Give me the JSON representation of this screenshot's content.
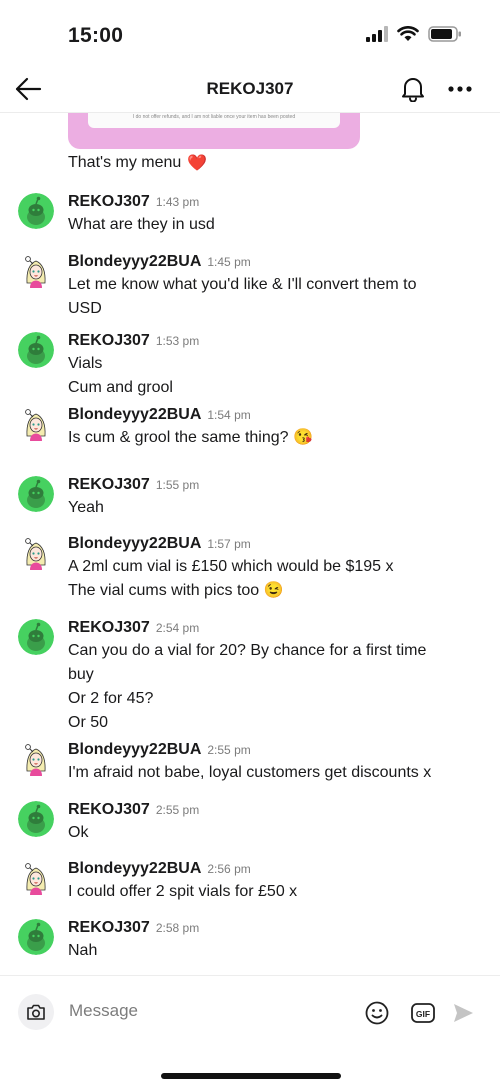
{
  "status_bar": {
    "time": "15:00"
  },
  "header": {
    "title": "REKOJ307"
  },
  "menu": {
    "fine_print": "I do not offer refunds, and I am not liable once your item has been posted",
    "caption": "That's my menu",
    "caption_emoji": "❤️"
  },
  "messages": [
    {
      "author": "REKOJ307",
      "time": "1:43 pm",
      "avatar": "snoo-avatar",
      "lines": [
        "What are they in usd"
      ]
    },
    {
      "author": "Blondeyyy22BUA",
      "time": "1:45 pm",
      "avatar": "blonde-avatar",
      "lines": [
        "Let me know what you'd like & I'll convert them to",
        "USD"
      ]
    },
    {
      "author": "REKOJ307",
      "time": "1:53 pm",
      "avatar": "snoo-avatar",
      "lines": [
        "Vials",
        "Cum and grool"
      ]
    },
    {
      "author": "Blondeyyy22BUA",
      "time": "1:54 pm",
      "avatar": "blonde-avatar",
      "lines": [
        "Is cum & grool the same thing? 😘"
      ]
    },
    {
      "author": "REKOJ307",
      "time": "1:55 pm",
      "avatar": "snoo-avatar",
      "lines": [
        "Yeah"
      ]
    },
    {
      "author": "Blondeyyy22BUA",
      "time": "1:57 pm",
      "avatar": "blonde-avatar",
      "lines": [
        "A 2ml cum vial is £150 which would be $195 x",
        "The vial cums with pics too 😉"
      ]
    },
    {
      "author": "REKOJ307",
      "time": "2:54 pm",
      "avatar": "snoo-avatar",
      "lines": [
        "Can you do a vial for 20? By chance for a first time",
        "buy",
        "Or 2 for 45?",
        "Or 50"
      ]
    },
    {
      "author": "Blondeyyy22BUA",
      "time": "2:55 pm",
      "avatar": "blonde-avatar",
      "lines": [
        "I'm afraid not babe, loyal customers get discounts x"
      ]
    },
    {
      "author": "REKOJ307",
      "time": "2:55 pm",
      "avatar": "snoo-avatar",
      "lines": [
        "Ok"
      ]
    },
    {
      "author": "Blondeyyy22BUA",
      "time": "2:56 pm",
      "avatar": "blonde-avatar",
      "lines": [
        "I could offer 2 spit vials for £50 x"
      ]
    },
    {
      "author": "REKOJ307",
      "time": "2:58 pm",
      "avatar": "snoo-avatar",
      "lines": [
        "Nah"
      ]
    }
  ],
  "composer": {
    "placeholder": "Message",
    "gif_label": "GIF"
  }
}
